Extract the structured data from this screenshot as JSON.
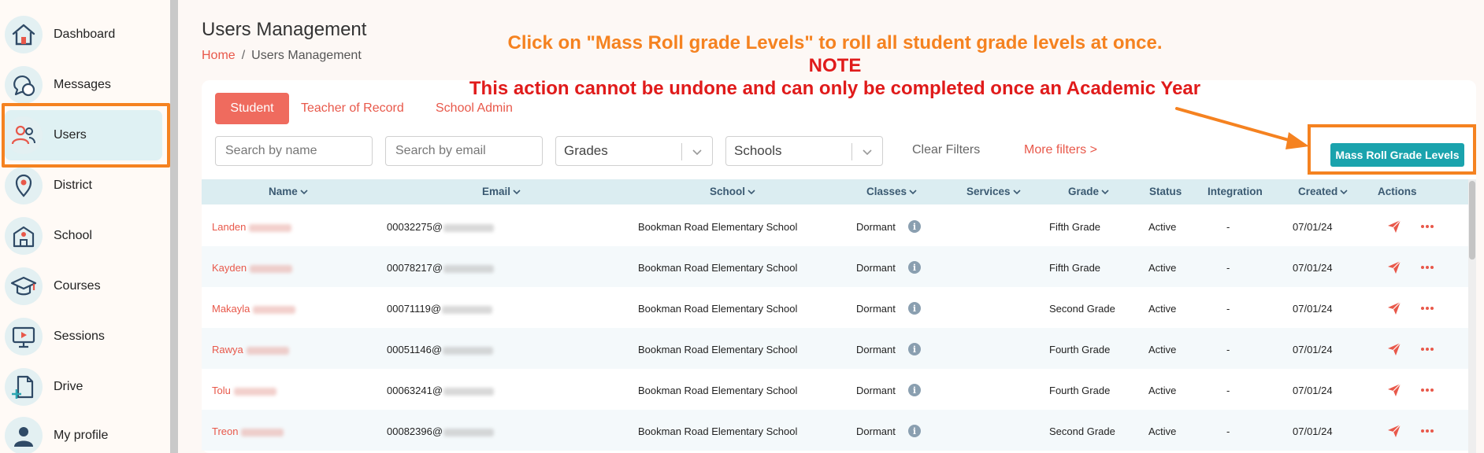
{
  "sidebar": {
    "items": [
      {
        "label": "Dashboard",
        "icon": "home-icon"
      },
      {
        "label": "Messages",
        "icon": "messages-icon"
      },
      {
        "label": "Users",
        "icon": "users-icon",
        "active": true
      },
      {
        "label": "District",
        "icon": "location-pin-icon"
      },
      {
        "label": "School",
        "icon": "school-icon"
      },
      {
        "label": "Courses",
        "icon": "graduation-cap-icon"
      },
      {
        "label": "Sessions",
        "icon": "presentation-icon"
      },
      {
        "label": "Drive",
        "icon": "file-add-icon"
      },
      {
        "label": "My profile",
        "icon": "profile-icon"
      }
    ]
  },
  "header": {
    "title": "Users Management",
    "breadcrumb": {
      "home": "Home",
      "separator": "/",
      "current": "Users Management"
    }
  },
  "callout": {
    "line1": "Click on \"Mass Roll grade Levels\" to roll all student grade levels at once.",
    "line2": "NOTE",
    "line3": "This action cannot be undone and can only be completed once an Academic Year"
  },
  "tabs": [
    {
      "label": "Student",
      "active": true
    },
    {
      "label": "Teacher of Record"
    },
    {
      "label": "School Admin"
    }
  ],
  "filters": {
    "search_name_placeholder": "Search by name",
    "search_email_placeholder": "Search by email",
    "grades_label": "Grades",
    "schools_label": "Schools",
    "clear_label": "Clear Filters",
    "more_label": "More filters >"
  },
  "mass_roll_button": "Mass Roll Grade Levels",
  "table": {
    "headers": [
      "Name",
      "Email",
      "School",
      "Classes",
      "Services",
      "Grade",
      "Status",
      "Integration",
      "Created",
      "Actions"
    ],
    "rows": [
      {
        "first": "Landen",
        "email_prefix": "00032275@",
        "school": "Bookman Road Elementary School",
        "classes": "Dormant",
        "grade": "Fifth Grade",
        "status": "Active",
        "integration": "-",
        "created": "07/01/24"
      },
      {
        "first": "Kayden",
        "email_prefix": "00078217@",
        "school": "Bookman Road Elementary School",
        "classes": "Dormant",
        "grade": "Fifth Grade",
        "status": "Active",
        "integration": "-",
        "created": "07/01/24"
      },
      {
        "first": "Makayla",
        "email_prefix": "00071119@",
        "school": "Bookman Road Elementary School",
        "classes": "Dormant",
        "grade": "Second Grade",
        "status": "Active",
        "integration": "-",
        "created": "07/01/24"
      },
      {
        "first": "Rawya",
        "email_prefix": "00051146@",
        "school": "Bookman Road Elementary School",
        "classes": "Dormant",
        "grade": "Fourth Grade",
        "status": "Active",
        "integration": "-",
        "created": "07/01/24"
      },
      {
        "first": "Tolu",
        "email_prefix": "00063241@",
        "school": "Bookman Road Elementary School",
        "classes": "Dormant",
        "grade": "Fourth Grade",
        "status": "Active",
        "integration": "-",
        "created": "07/01/24"
      },
      {
        "first": "Treon",
        "email_prefix": "00082396@",
        "school": "Bookman Road Elementary School",
        "classes": "Dormant",
        "grade": "Second Grade",
        "status": "Active",
        "integration": "-",
        "created": "07/01/24"
      }
    ]
  },
  "colors": {
    "accent": "#e8584a",
    "tab_active": "#ef6b5e",
    "teal_button": "#1aa3ad",
    "highlight": "#f58220",
    "note_red": "#e01b1b",
    "header_bg": "#dbedf1"
  }
}
